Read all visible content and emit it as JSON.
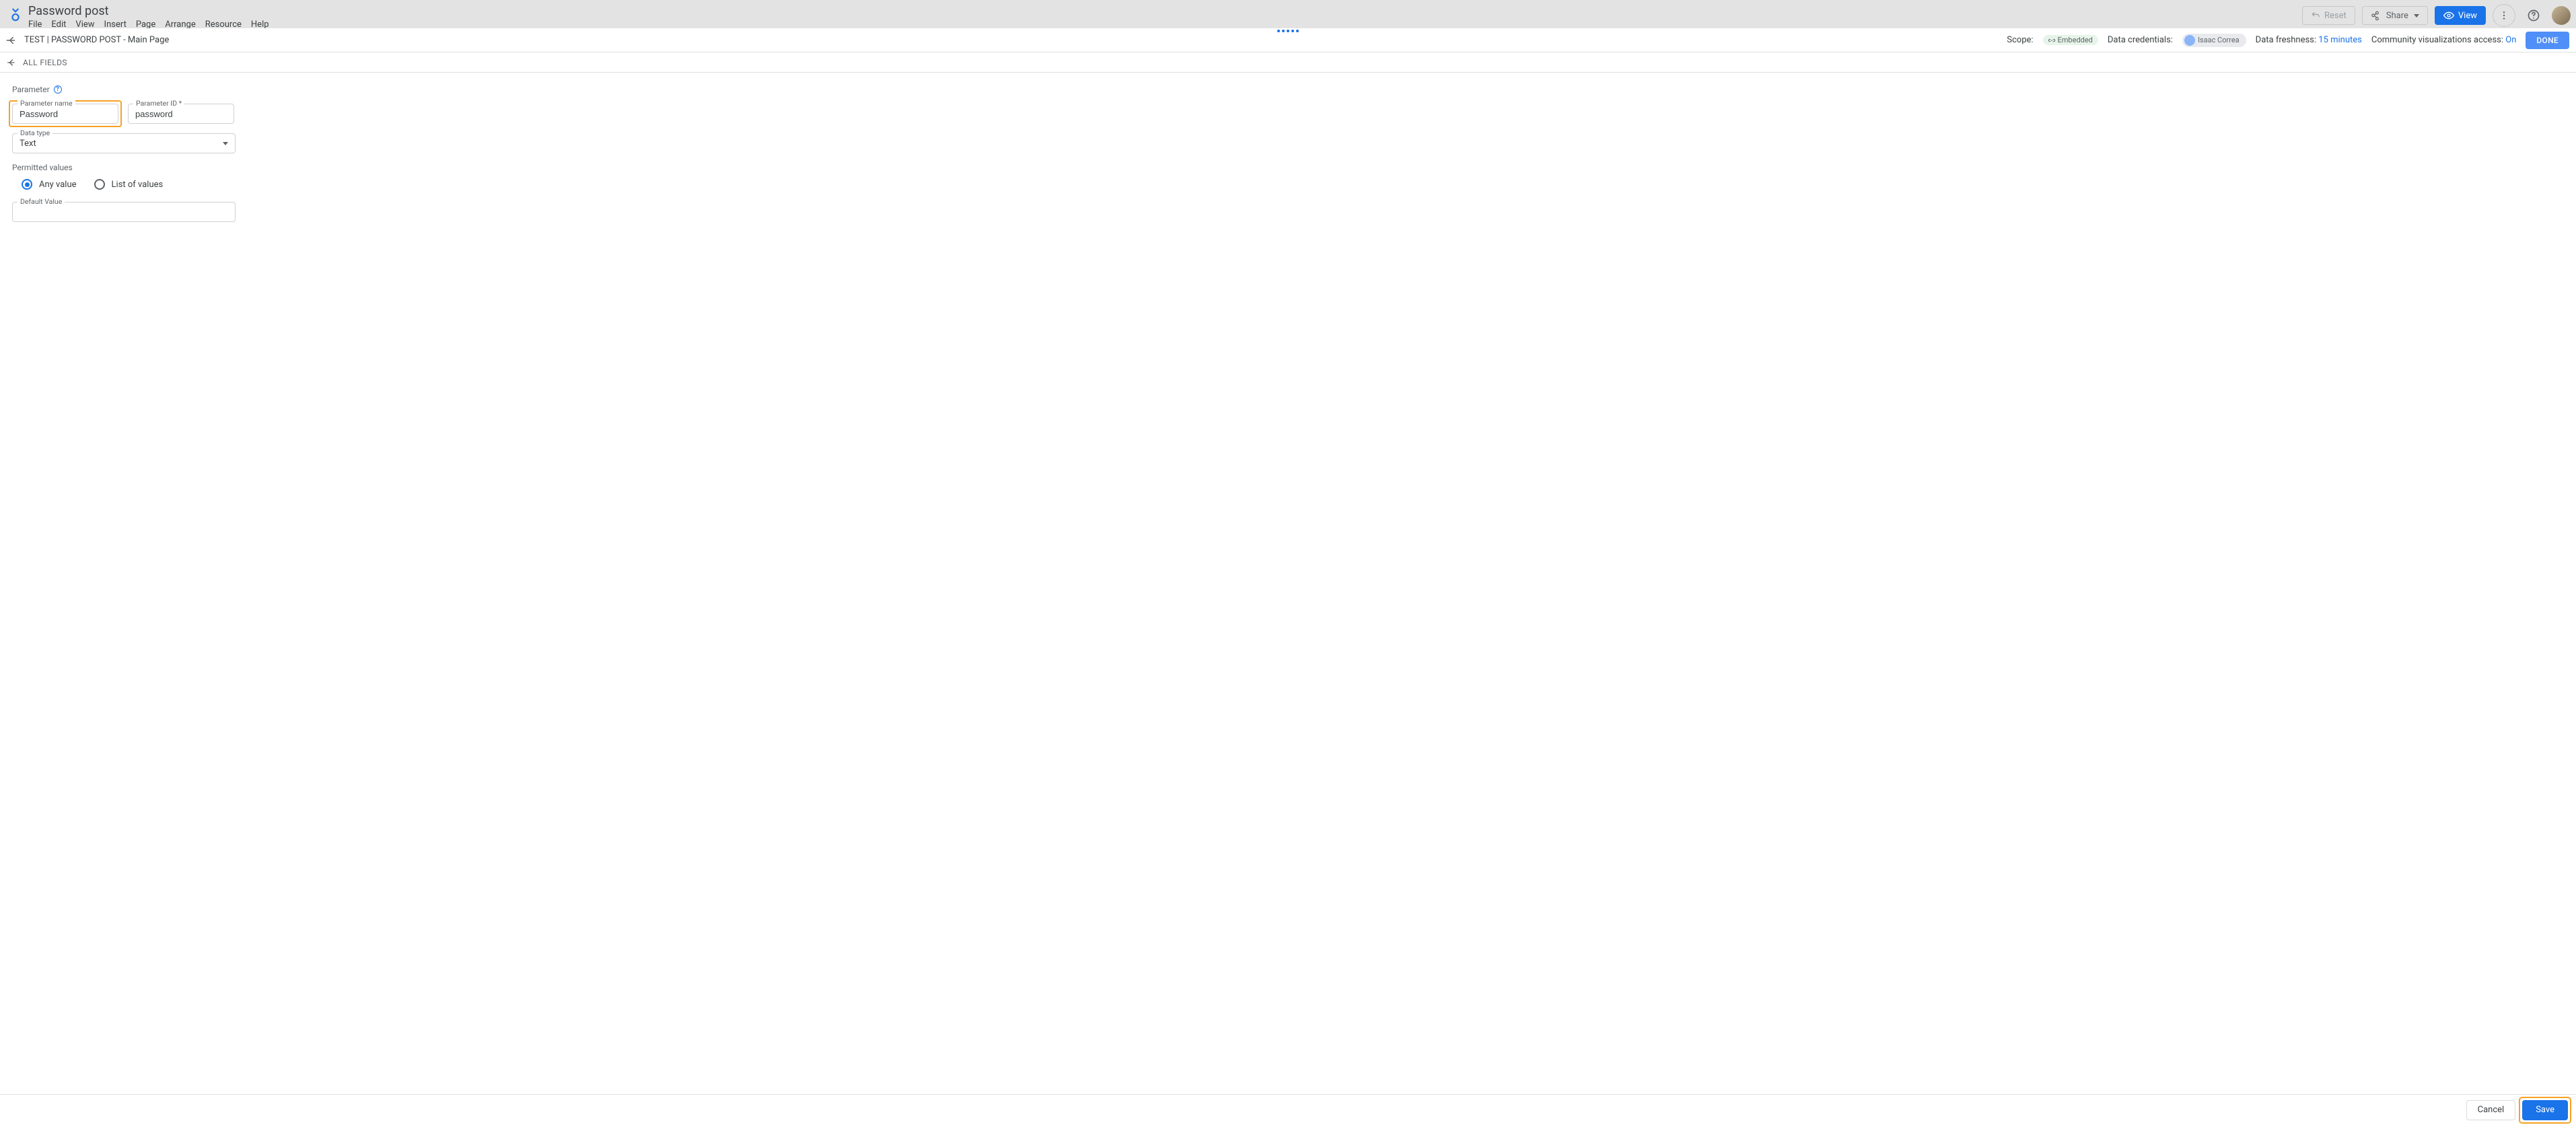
{
  "header": {
    "doc_title": "Password post",
    "menu": [
      "File",
      "Edit",
      "View",
      "Insert",
      "Page",
      "Arrange",
      "Resource",
      "Help"
    ],
    "reset_label": "Reset",
    "share_label": "Share",
    "view_label": "View"
  },
  "subheader": {
    "breadcrumb": "TEST | PASSWORD POST - Main Page",
    "scope_label": "Scope:",
    "scope_value": "Embedded",
    "data_credentials_label": "Data credentials:",
    "data_credentials_user": "Isaac Correa",
    "freshness_label": "Data freshness:",
    "freshness_value": "15 minutes",
    "community_label": "Community visualizations access:",
    "community_value": "On",
    "done_label": "DONE"
  },
  "fields_nav": {
    "label": "ALL FIELDS"
  },
  "editor": {
    "section_title": "Parameter",
    "fields": {
      "name_label": "Parameter name",
      "name_value": "Password",
      "id_label": "Parameter ID *",
      "id_value": "password",
      "type_label": "Data type",
      "type_value": "Text"
    },
    "permitted_label": "Permitted values",
    "radios": {
      "any": "Any value",
      "list": "List of values",
      "selected": "any"
    },
    "default_label": "Default Value",
    "default_value": ""
  },
  "footer": {
    "cancel_label": "Cancel",
    "save_label": "Save"
  }
}
